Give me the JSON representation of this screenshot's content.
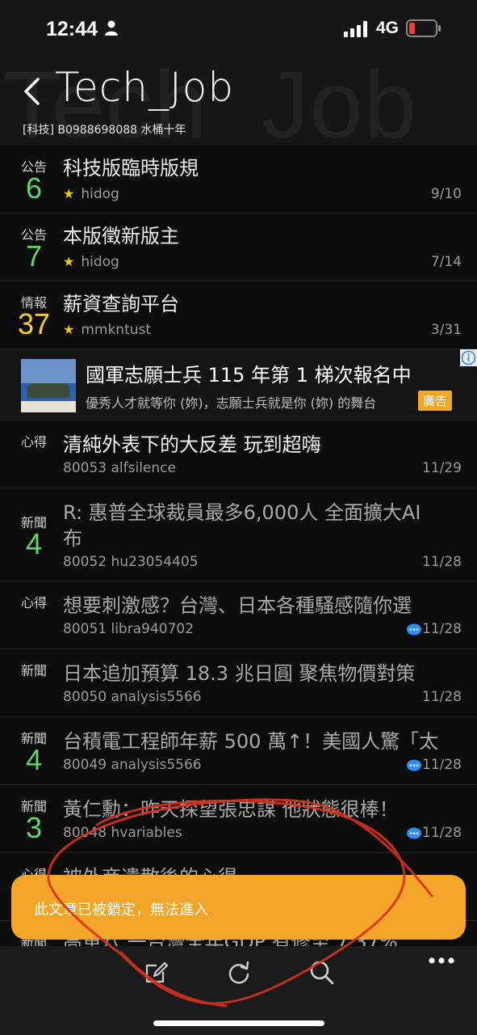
{
  "status_bar": {
    "time": "12:44",
    "network": "4G"
  },
  "header": {
    "watermark": "Tech_Job",
    "title": "Tech_Job",
    "subtitle": "[科技] B0988698088 水桶十年"
  },
  "pinned": [
    {
      "tag": "公告",
      "count": "6",
      "title": "科技版臨時版規",
      "author": "hidog",
      "date": "9/10"
    },
    {
      "tag": "公告",
      "count": "7",
      "title": "本版徵新版主",
      "author": "hidog",
      "date": "7/14"
    },
    {
      "tag": "情報",
      "count": "37",
      "title": "薪資查詢平台",
      "author": "mmkntust",
      "date": "3/31"
    }
  ],
  "ad": {
    "title": "國軍志願士兵 115 年第 1 梯次報名中",
    "description": "優秀人才就等你 (妳)，志願士兵就是你 (妳) 的舞台",
    "badge": "廣告"
  },
  "posts": [
    {
      "tag": "心得",
      "count": "",
      "title": "清純外表下的大反差 玩到超嗨",
      "author": "80053  alfsilence",
      "date": "11/29"
    },
    {
      "tag": "新聞",
      "count": "4",
      "title": "R: 惠普全球裁員最多6,000人 全面擴大AI",
      "title2": "布",
      "author": "80052  hu23054405",
      "date": "11/28"
    },
    {
      "tag": "心得",
      "count": "",
      "title": "想要刺激感？台灣、日本各種騷感隨你選",
      "author": "80051  libra940702",
      "date": "11/28"
    },
    {
      "tag": "新聞",
      "count": "",
      "title": "日本追加預算 18.3 兆日圓 聚焦物價對策",
      "author": "80050  analysis5566",
      "date": "11/28"
    },
    {
      "tag": "新聞",
      "count": "4",
      "title": "台積電工程師年薪 500 萬↑！美國人驚「太",
      "author": "80049  analysis5566",
      "date": "11/28"
    },
    {
      "tag": "新聞",
      "count": "3",
      "title": "黃仁勳：昨天探望張忠謀 他狀態很棒！",
      "author": "80048  hvariables",
      "date": "11/28"
    },
    {
      "tag": "心得",
      "count": "",
      "title": "被外商遣散後的心得",
      "author": "",
      "date": ""
    },
    {
      "tag": "新聞",
      "count": "",
      "title": "高車八 一台灣全年GDP 有修至 7.37%",
      "author": "",
      "date": ""
    }
  ],
  "toast": {
    "message": "此文章已被鎖定，無法進入"
  },
  "colors": {
    "accent_orange": "#f3a52a",
    "count_green": "#62d36a",
    "count_yellow": "#f5cf32",
    "star": "#f3c518",
    "comment_blue": "#2f8cf5"
  },
  "icons": [
    "person-icon",
    "signal-icon",
    "battery-icon",
    "back-icon",
    "star-icon",
    "comment-icon",
    "adinfo-icon",
    "compose-icon",
    "refresh-icon",
    "search-icon",
    "more-icon"
  ]
}
